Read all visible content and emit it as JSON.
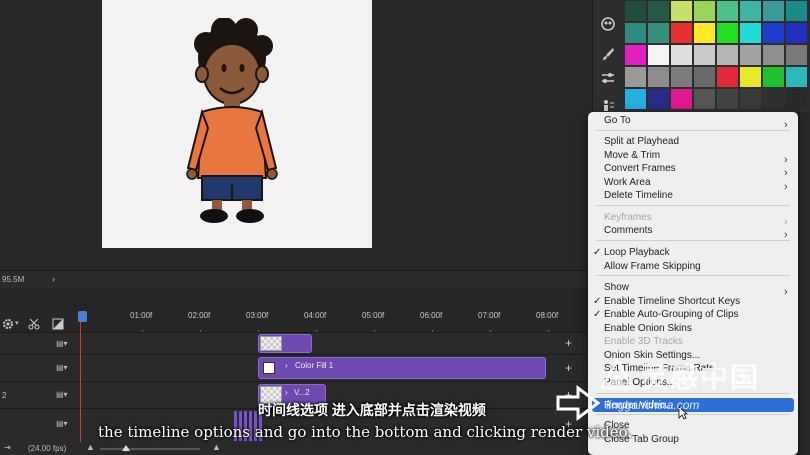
{
  "status_bar": {
    "zoom_level": "95.5M",
    "arrow": "›"
  },
  "timeline": {
    "ruler_labels": [
      "01:00f",
      "02:00f",
      "03:00f",
      "04:00f",
      "05:00f",
      "06:00f",
      "07:00f",
      "08:00f"
    ],
    "fps": "(24.00 fps)",
    "tracks": [
      {
        "clip_label": ""
      },
      {
        "clip_label": "Color Fill 1"
      },
      {
        "clip_label": "V...2"
      },
      {
        "clip_label": ""
      }
    ],
    "row_number": "2"
  },
  "menu": {
    "items": [
      {
        "label": "Go To",
        "submenu": true,
        "checked": false,
        "disabled": false
      },
      {
        "label": "Split at Playhead",
        "submenu": false,
        "checked": false,
        "disabled": false
      },
      {
        "label": "Move & Trim",
        "submenu": true,
        "checked": false,
        "disabled": false
      },
      {
        "label": "Convert Frames",
        "submenu": true,
        "checked": false,
        "disabled": false
      },
      {
        "label": "Work Area",
        "submenu": true,
        "checked": false,
        "disabled": false
      },
      {
        "label": "Delete Timeline",
        "submenu": false,
        "checked": false,
        "disabled": false
      },
      {
        "label": "Keyframes",
        "submenu": true,
        "checked": false,
        "disabled": true
      },
      {
        "label": "Comments",
        "submenu": true,
        "checked": false,
        "disabled": false
      },
      {
        "label": "Loop Playback",
        "submenu": false,
        "checked": true,
        "disabled": false
      },
      {
        "label": "Allow Frame Skipping",
        "submenu": false,
        "checked": false,
        "disabled": false
      },
      {
        "label": "Show",
        "submenu": true,
        "checked": false,
        "disabled": false
      },
      {
        "label": "Enable Timeline Shortcut Keys",
        "submenu": false,
        "checked": true,
        "disabled": false
      },
      {
        "label": "Enable Auto-Grouping of Clips",
        "submenu": false,
        "checked": true,
        "disabled": false
      },
      {
        "label": "Enable Onion Skins",
        "submenu": false,
        "checked": false,
        "disabled": false
      },
      {
        "label": "Enable 3D Tracks",
        "submenu": false,
        "checked": false,
        "disabled": true
      },
      {
        "label": "Onion Skin Settings...",
        "submenu": false,
        "checked": false,
        "disabled": false
      },
      {
        "label": "Set Timeline Frame Rate...",
        "submenu": false,
        "checked": false,
        "disabled": false
      },
      {
        "label": "Panel Options...",
        "submenu": false,
        "checked": false,
        "disabled": false
      },
      {
        "label": "Render Video...",
        "submenu": false,
        "checked": false,
        "disabled": false,
        "highlighted": true
      },
      {
        "label": "Close",
        "submenu": false,
        "checked": false,
        "disabled": false
      },
      {
        "label": "Close Tab Group",
        "submenu": false,
        "checked": false,
        "disabled": false
      }
    ],
    "check_glyph": "✓",
    "submenu_glyph": "›"
  },
  "swatches": {
    "colors": [
      "#1f4d40",
      "#255a48",
      "#c8e06a",
      "#9ad45a",
      "#4fc08a",
      "#3fb3a6",
      "#3a9a9a",
      "#1d8a8a",
      "#2f8a80",
      "#3a9080",
      "#e53030",
      "#ffe82a",
      "#22dd22",
      "#22d8d8",
      "#1f3ed0",
      "#1f2fbf",
      "#e020c0",
      "#f4f4f4",
      "#dedede",
      "#cacaca",
      "#b6b6b6",
      "#a2a2a2",
      "#8e8e8e",
      "#7a7a7a",
      "#9a9a9a",
      "#8c8c8c",
      "#7c7c7c",
      "#6a6a6a",
      "#e02a3a",
      "#e8e82a",
      "#22c030",
      "#2ab8b8",
      "#22b0e0",
      "#2a2a8a",
      "#e01a90",
      "#555555",
      "#444444",
      "#3a3a3a",
      "#303030",
      "#2a2a2a"
    ]
  },
  "subtitles": {
    "chinese": "时间线选项 进入底部并点击渲染视频",
    "english": "the timeline options and go into the bottom and clicking render video."
  },
  "watermark": {
    "chinese": "灵感中国",
    "url": "lingganchina.com"
  }
}
